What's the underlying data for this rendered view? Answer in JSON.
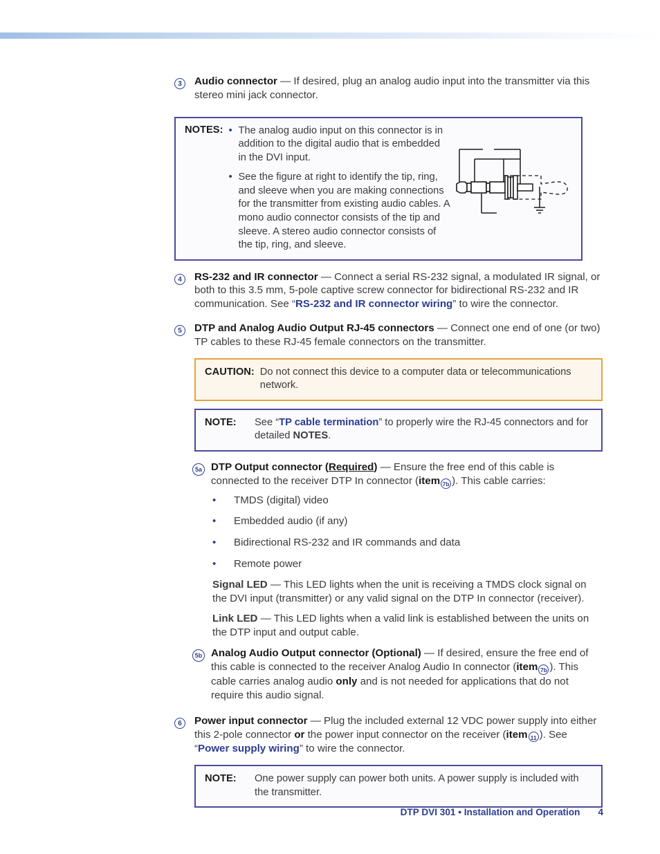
{
  "page": {
    "footer_title": "DTP DVI 301 • Installation and Operation",
    "page_number": "4",
    "accent_blue": "#2b3c8f",
    "note_border": "#4a4a9c",
    "caution_border": "#e7a33c",
    "caution_bg": "#fdf6ec"
  },
  "items": {
    "item3": {
      "badge": "3",
      "title": "Audio connector",
      "dash": " — ",
      "body": "If desired, plug an analog audio input into the transmitter via this stereo mini jack connector."
    },
    "notes_box": {
      "label": "NOTES:",
      "bullet1": "The analog audio input on this connector is in addition to the digital audio that is embedded in the DVI input.",
      "bullet2": "See the figure at right to identify the tip, ring, and sleeve when you are making connections for the transmitter from existing audio cables. A mono audio connector consists of the tip and sleeve. A stereo audio connector consists of the tip, ring, and sleeve.",
      "figure_name": "stereo-mini-jack-tip-ring-sleeve-diagram"
    },
    "item4": {
      "badge": "4",
      "title": "RS-232 and IR connector",
      "dash": " — ",
      "body_1": "Connect a serial RS-232 signal, a modulated IR signal, or both to this 3.5 mm, 5-pole captive screw connector for bidirectional RS-232 and IR communication. See “",
      "link": "RS-232 and IR connector wiring",
      "body_2": "” to wire the connector."
    },
    "item5": {
      "badge": "5",
      "title": "DTP and Analog Audio Output RJ-45 connectors",
      "dash": " — ",
      "body": "Connect one end of one (or two) TP cables to these RJ-45 female connectors on the transmitter."
    },
    "caution_box": {
      "label": "CAUTION:",
      "text": "Do not connect this device to a computer data or telecommunications network."
    },
    "note_box_tp": {
      "label": "NOTE:",
      "text_1": "See “",
      "link": "TP cable termination",
      "text_2": "” to properly wire the RJ-45 connectors and for detailed ",
      "bold_word": "NOTES",
      "text_3": "."
    },
    "item5a": {
      "badge": "5a",
      "title_1": "DTP Output connector (",
      "title_underlined": "Required",
      "title_2": ")",
      "dash": " — ",
      "body_1": "Ensure the free end of this cable is connected to the receiver DTP In connector (",
      "item_word": "item",
      "item_badge": "7b",
      "body_2": "). This cable carries:",
      "bullets": [
        "TMDS (digital) video",
        "Embedded audio (if any)",
        "Bidirectional RS-232 and IR commands and data",
        "Remote power"
      ],
      "signal_led_title": "Signal LED",
      "signal_led_dash": " — ",
      "signal_led_body": "This LED lights when the unit is receiving a TMDS clock signal on the DVI input (transmitter) or any valid signal on the DTP In connector (receiver).",
      "link_led_title": "Link LED",
      "link_led_dash": " — ",
      "link_led_body": "This LED lights when a valid link is established between the units on the DTP input and output cable."
    },
    "item5b": {
      "badge": "5b",
      "title": "Analog Audio Output connector (Optional)",
      "dash": " — ",
      "body_1": "If desired, ensure the free end of this cable is connected to the receiver Analog Audio In connector (",
      "item_word": "item",
      "item_badge": "7b",
      "body_2": "). This cable carries analog audio ",
      "bold_word": "only",
      "body_3": " and is not needed for applications that do not require this audio signal."
    },
    "item6": {
      "badge": "6",
      "title": "Power input connector",
      "dash": " — ",
      "body_1": "Plug the included external 12 VDC power supply into either this 2-pole connector ",
      "bold_word": "or",
      "body_2": " the power input connector on the receiver (",
      "item_word": "item",
      "item_badge": "11",
      "body_3": "). See “",
      "link": "Power supply wiring",
      "body_4": "” to wire the connector."
    },
    "note_box_power": {
      "label": "NOTE:",
      "text": "One power supply can power both units. A power supply is included with the transmitter."
    }
  }
}
